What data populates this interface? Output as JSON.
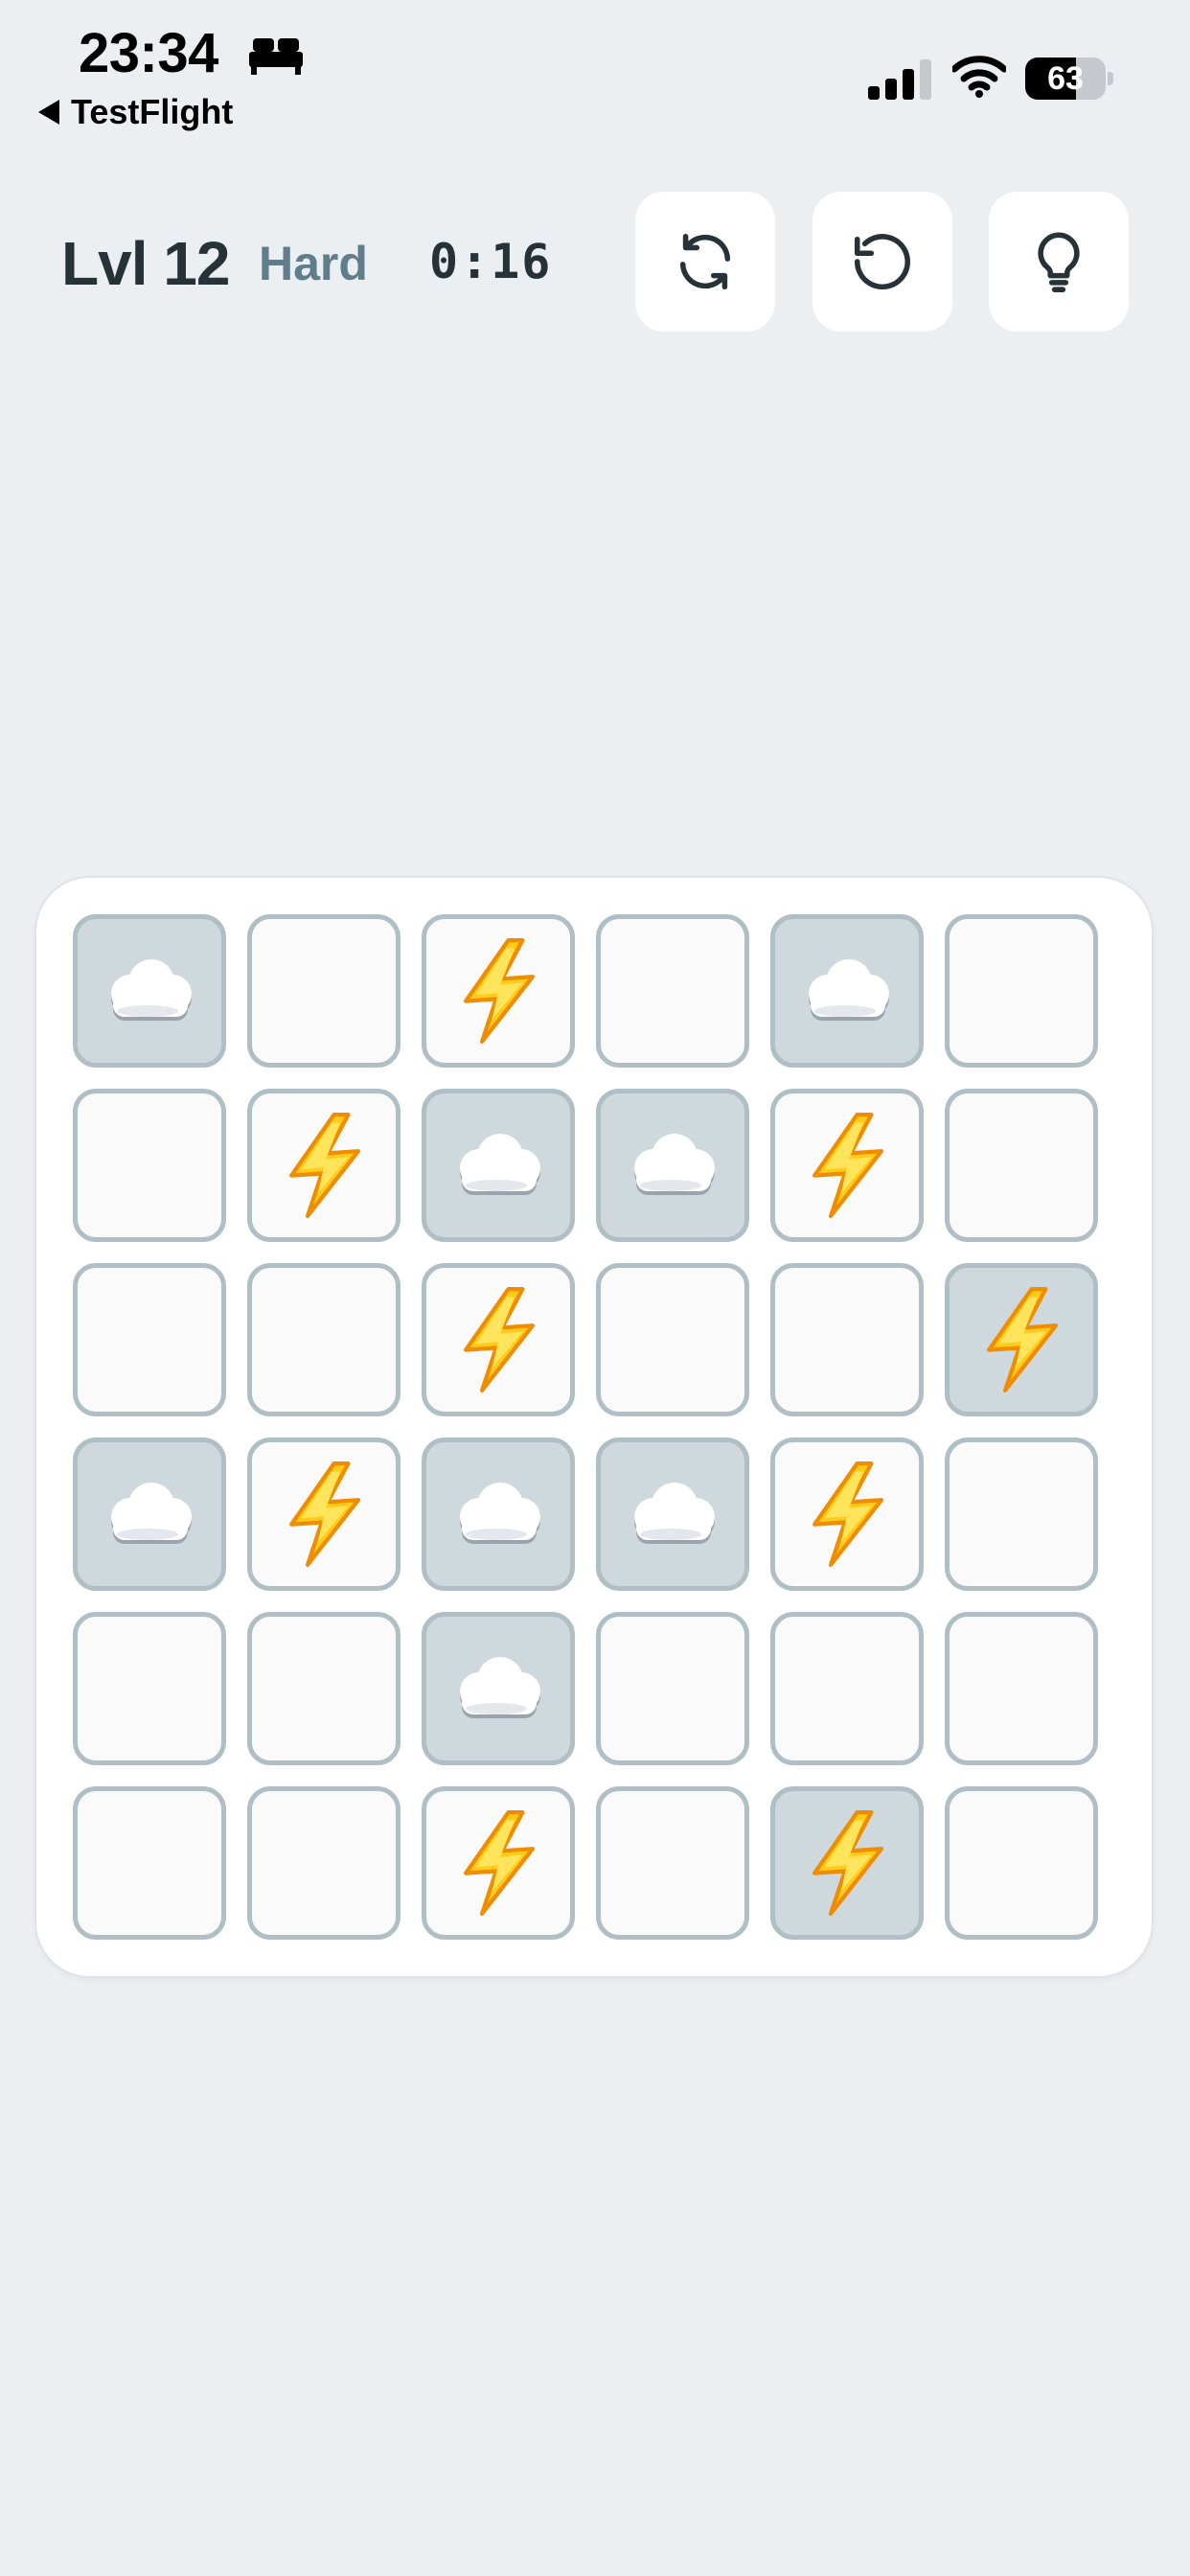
{
  "status_bar": {
    "time": "23:34",
    "back_label": "TestFlight",
    "battery_percent": "63",
    "battery_level": 0.63
  },
  "header": {
    "level": "Lvl 12",
    "difficulty": "Hard",
    "timer": "0:16"
  },
  "toolbar": {
    "buttons": [
      {
        "icon": "refresh-icon"
      },
      {
        "icon": "undo-icon"
      },
      {
        "icon": "lightbulb-icon"
      }
    ]
  },
  "board": {
    "rows": 6,
    "cols": 6,
    "symbols": {
      "S": "lightning-bolt",
      "C": "cloud"
    },
    "cells": [
      [
        "C",
        "",
        "S",
        "",
        "C",
        ""
      ],
      [
        "",
        "S",
        "C",
        "C",
        "S",
        ""
      ],
      [
        "",
        "",
        "S",
        "",
        "",
        "S"
      ],
      [
        "C",
        "S",
        "C",
        "C",
        "S",
        ""
      ],
      [
        "",
        "",
        "C",
        "",
        "",
        ""
      ],
      [
        "",
        "",
        "S",
        "",
        "S",
        ""
      ]
    ],
    "locked": [
      [
        true,
        false,
        false,
        false,
        true,
        false
      ],
      [
        false,
        false,
        true,
        true,
        false,
        false
      ],
      [
        false,
        false,
        false,
        false,
        false,
        true
      ],
      [
        true,
        false,
        true,
        true,
        false,
        false
      ],
      [
        false,
        false,
        true,
        false,
        false,
        false
      ],
      [
        false,
        false,
        false,
        false,
        true,
        false
      ]
    ]
  },
  "colors": {
    "background": "#ebeff2",
    "cell_border": "#b0bec5",
    "cell_empty": "#fafafa",
    "cell_locked": "#cfd8dc",
    "text_dark": "#263238",
    "text_muted": "#607d8b"
  }
}
